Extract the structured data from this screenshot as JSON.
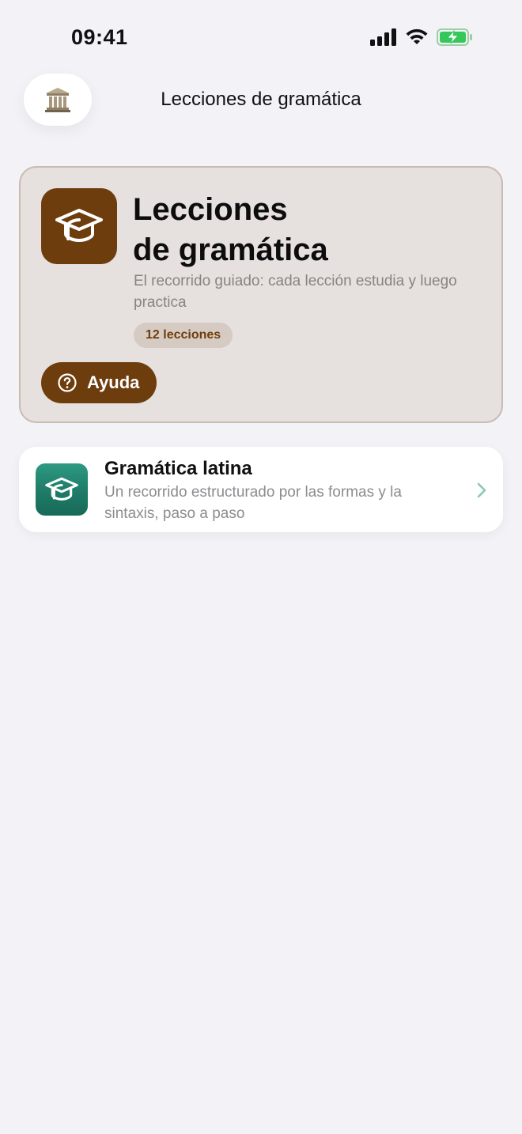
{
  "status_bar": {
    "time": "09:41"
  },
  "nav": {
    "title": "Lecciones de gramática",
    "home_icon": "classical-building-icon"
  },
  "hero": {
    "title_line1": "Lecciones",
    "title_line2": "de gramática",
    "subtitle": "El recorrido guiado: cada lección estudia y luego practica",
    "badge": "12 lecciones",
    "help_label": "Ayuda",
    "icon": "graduation-cap-icon",
    "accent": "#6e3d0d"
  },
  "courses": [
    {
      "title": "Gramática latina",
      "description": "Un recorrido estructurado por las formas y la sintaxis, paso a paso",
      "icon": "graduation-cap-icon",
      "accent": "#1f7d69"
    }
  ]
}
